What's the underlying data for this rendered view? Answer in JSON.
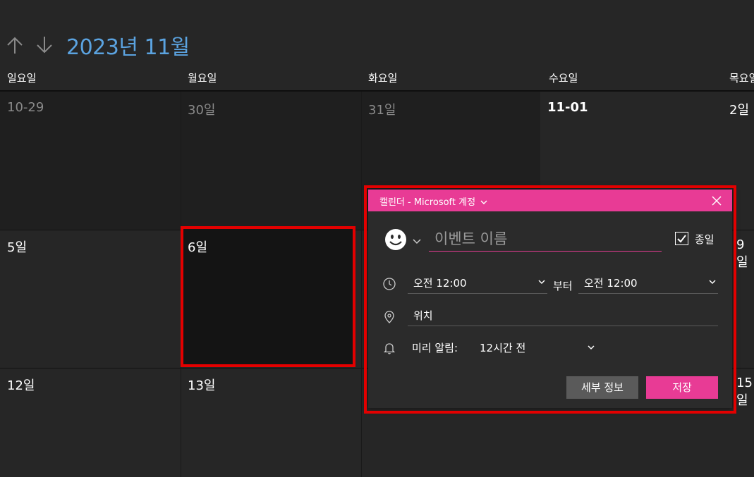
{
  "header": {
    "month_title": "2023년 11월",
    "nav_up_icon": "arrow-up-icon",
    "nav_down_icon": "arrow-down-icon"
  },
  "weekdays": [
    "일요일",
    "월요일",
    "화요일",
    "수요일",
    "목요일"
  ],
  "weeks": [
    [
      "10-29",
      "30일",
      "31일",
      "11-01",
      "2일"
    ],
    [
      "5일",
      "6일",
      "",
      "",
      "9일"
    ],
    [
      "12일",
      "13일",
      "",
      "",
      "15일"
    ]
  ],
  "popup": {
    "calendar_title": "캘린더 - Microsoft 계정",
    "close_icon": "close-icon",
    "emoji_icon": "smiley-icon",
    "event_name_placeholder": "이벤트 이름",
    "all_day_label": "종일",
    "all_day_checked": true,
    "start_time": "오전 12:00",
    "from_label": "부터",
    "end_time": "오전 12:00",
    "location_placeholder": "위치",
    "reminder_label": "미리 알림:",
    "reminder_value": "12시간 전",
    "details_button": "세부 정보",
    "save_button": "저장",
    "accent_color": "#e83b95"
  },
  "colors": {
    "background": "#262626",
    "title_blue": "#5ba3e0",
    "highlight_red": "#e30000"
  }
}
